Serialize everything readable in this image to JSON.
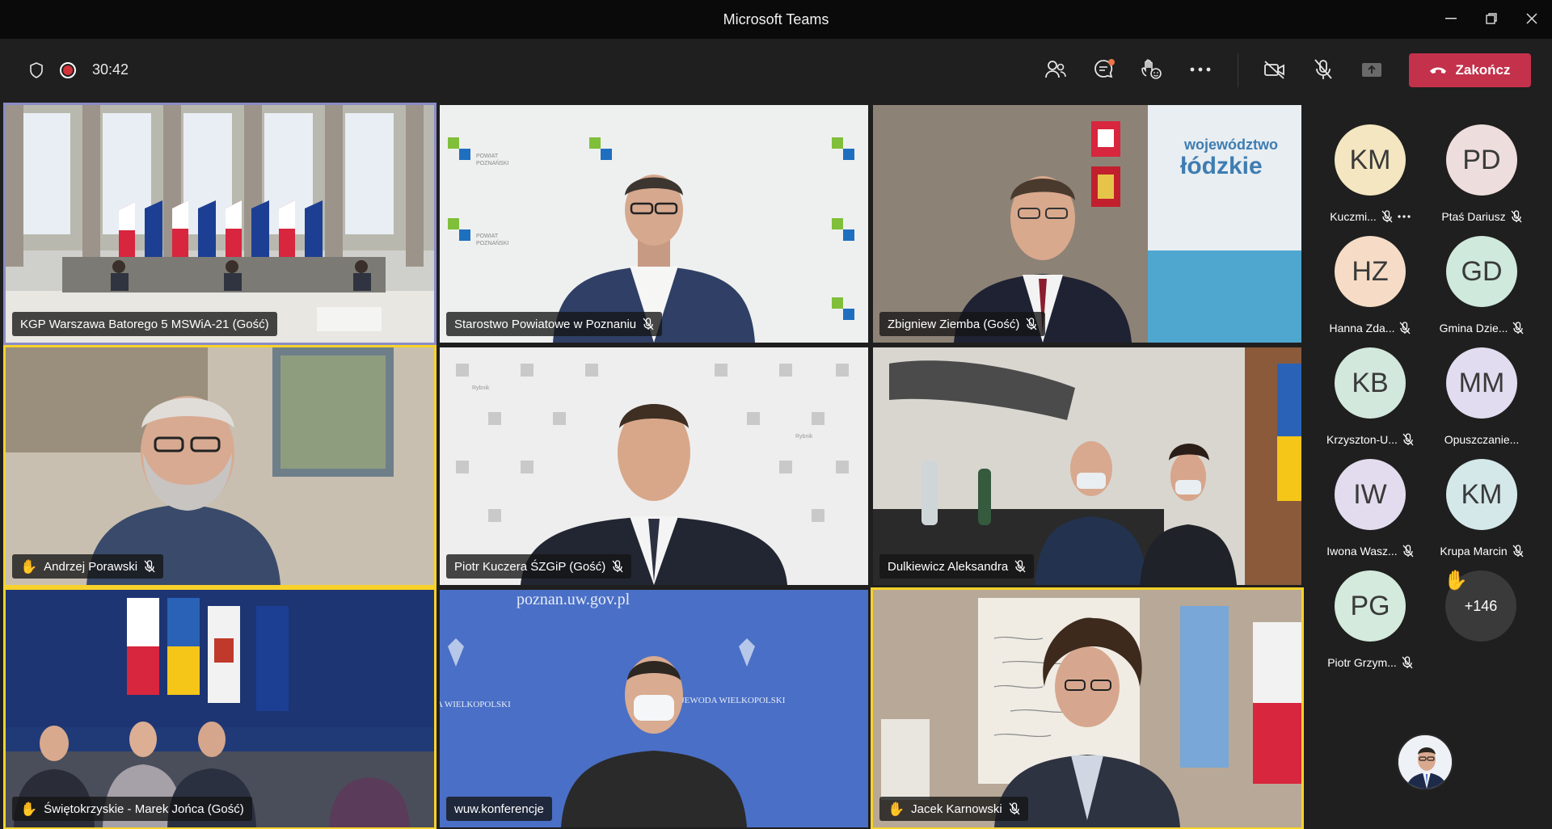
{
  "app": {
    "title": "Microsoft Teams"
  },
  "toolbar": {
    "timer": "30:42",
    "leave_label": "Zakończ"
  },
  "colors": {
    "accent_speaking": "#8b8cc7",
    "hand_raised": "#f8d22a",
    "leave_red": "#c4314b",
    "recording_red": "#d13438"
  },
  "tiles": [
    {
      "name": "KGP Warszawa Batorego 5 MSWiA-21 (Gość)",
      "hand": false,
      "muted": false
    },
    {
      "name": "Starostwo Powiatowe w Poznaniu",
      "hand": false,
      "muted": true
    },
    {
      "name": "Zbigniew Ziemba (Gość)",
      "hand": false,
      "muted": true
    },
    {
      "name": "Andrzej Porawski",
      "hand": true,
      "muted": true
    },
    {
      "name": "Piotr Kuczera ŚZGiP (Gość)",
      "hand": false,
      "muted": true
    },
    {
      "name": "Dulkiewicz Aleksandra",
      "hand": false,
      "muted": true
    },
    {
      "name": "Świętokrzyskie - Marek Jońca (Gość)",
      "hand": true,
      "muted": false
    },
    {
      "name": "wuw.konferencje",
      "hand": false,
      "muted": false
    },
    {
      "name": "Jacek Karnowski",
      "hand": true,
      "muted": true
    }
  ],
  "tile_text": {
    "poznan_url": "poznan.uw.gov.pl",
    "lodzkie_top": "województwo",
    "lodzkie_bottom": "łódzkie",
    "powiat_line1": "POWIAT",
    "powiat_line2": "POZNAŃSKI",
    "wojewoda": "WOJEWODA WIELKOPOLSKI",
    "wielkopolski_side": "A WIELKOPOLSKI",
    "rybnik": "Rybnik"
  },
  "participants": [
    {
      "initials": "KM",
      "name": "Kuczmi...",
      "color": "#f4e6c0",
      "muted": true,
      "more": true
    },
    {
      "initials": "PD",
      "name": "Ptaś Dariusz",
      "color": "#eddedd",
      "muted": true,
      "more": false
    },
    {
      "initials": "HZ",
      "name": "Hanna Zda...",
      "color": "#f6dcc6",
      "muted": true,
      "more": false
    },
    {
      "initials": "GD",
      "name": "Gmina Dzie...",
      "color": "#cfe9dc",
      "muted": true,
      "more": false
    },
    {
      "initials": "KB",
      "name": "Krzyszton-U...",
      "color": "#d3e8dc",
      "muted": true,
      "more": false
    },
    {
      "initials": "MM",
      "name": "Opuszczanie...",
      "color": "#e1dcf0",
      "muted": false,
      "more": false
    },
    {
      "initials": "IW",
      "name": "Iwona Wasz...",
      "color": "#e3dcee",
      "muted": true,
      "more": false
    },
    {
      "initials": "KM",
      "name": "Krupa Marcin",
      "color": "#d4e8ea",
      "muted": true,
      "more": false
    },
    {
      "initials": "PG",
      "name": "Piotr Grzym...",
      "color": "#d3eadc",
      "muted": true,
      "more": false
    }
  ],
  "overflow": {
    "count_label": "+146",
    "hand": true
  }
}
